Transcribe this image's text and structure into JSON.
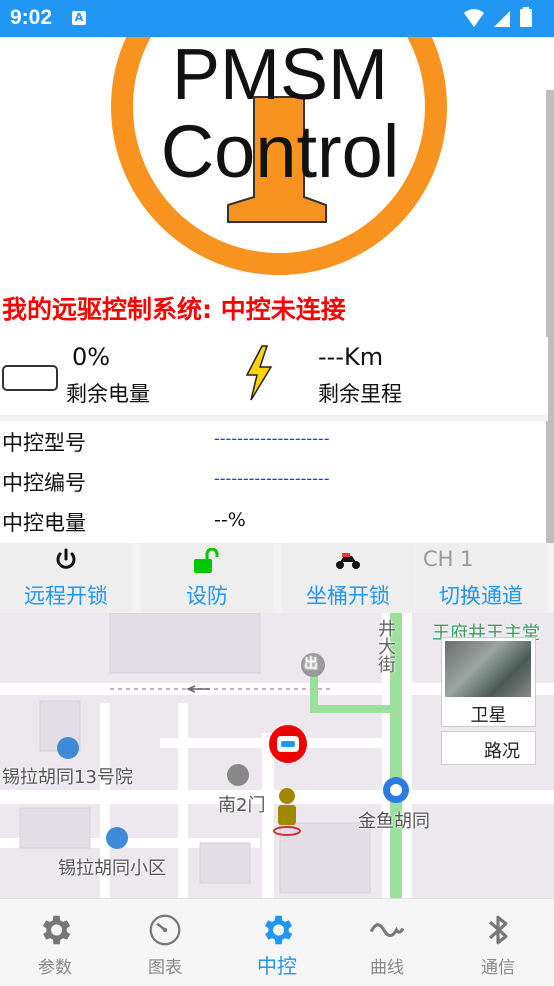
{
  "status_bar": {
    "time": "9:02",
    "notification_icon": "A"
  },
  "logo": {
    "line1": "PMSM",
    "line2": "Control"
  },
  "header": {
    "title": "我的远驱控制系统: 中控未连接"
  },
  "stats": {
    "battery_percent": "0%",
    "battery_label": "剩余电量",
    "range_value": "---Km",
    "range_label": "剩余里程"
  },
  "controller_info": [
    {
      "label": "中控型号",
      "value": "--------------------"
    },
    {
      "label": "中控编号",
      "value": "--------------------"
    },
    {
      "label": "中控电量",
      "value": "--%"
    }
  ],
  "actions": {
    "remote_unlock": "远程开锁",
    "arm": "设防",
    "seat_unlock": "坐桶开锁",
    "channel_value": "CH 1",
    "switch_channel": "切换通道"
  },
  "map": {
    "labels": {
      "street_vertical": "井大街",
      "alley13": "锡拉胡同13号院",
      "south_gate": "南2门",
      "jinyu": "金鱼胡同",
      "xila_district": "锡拉胡同小区",
      "top_right": "王府井王主堂",
      "exit_badge": "出"
    },
    "satellite_label": "卫星",
    "traffic_label": "路况"
  },
  "bottom_nav": [
    {
      "label": "参数",
      "icon": "gear-icon"
    },
    {
      "label": "图表",
      "icon": "dial-icon"
    },
    {
      "label": "中控",
      "icon": "gear-icon",
      "active": true
    },
    {
      "label": "曲线",
      "icon": "wave-icon"
    },
    {
      "label": "通信",
      "icon": "bluetooth-icon"
    }
  ],
  "colors": {
    "accent": "#2196F3",
    "alert": "#FF0000",
    "logo_orange": "#F7931E"
  }
}
